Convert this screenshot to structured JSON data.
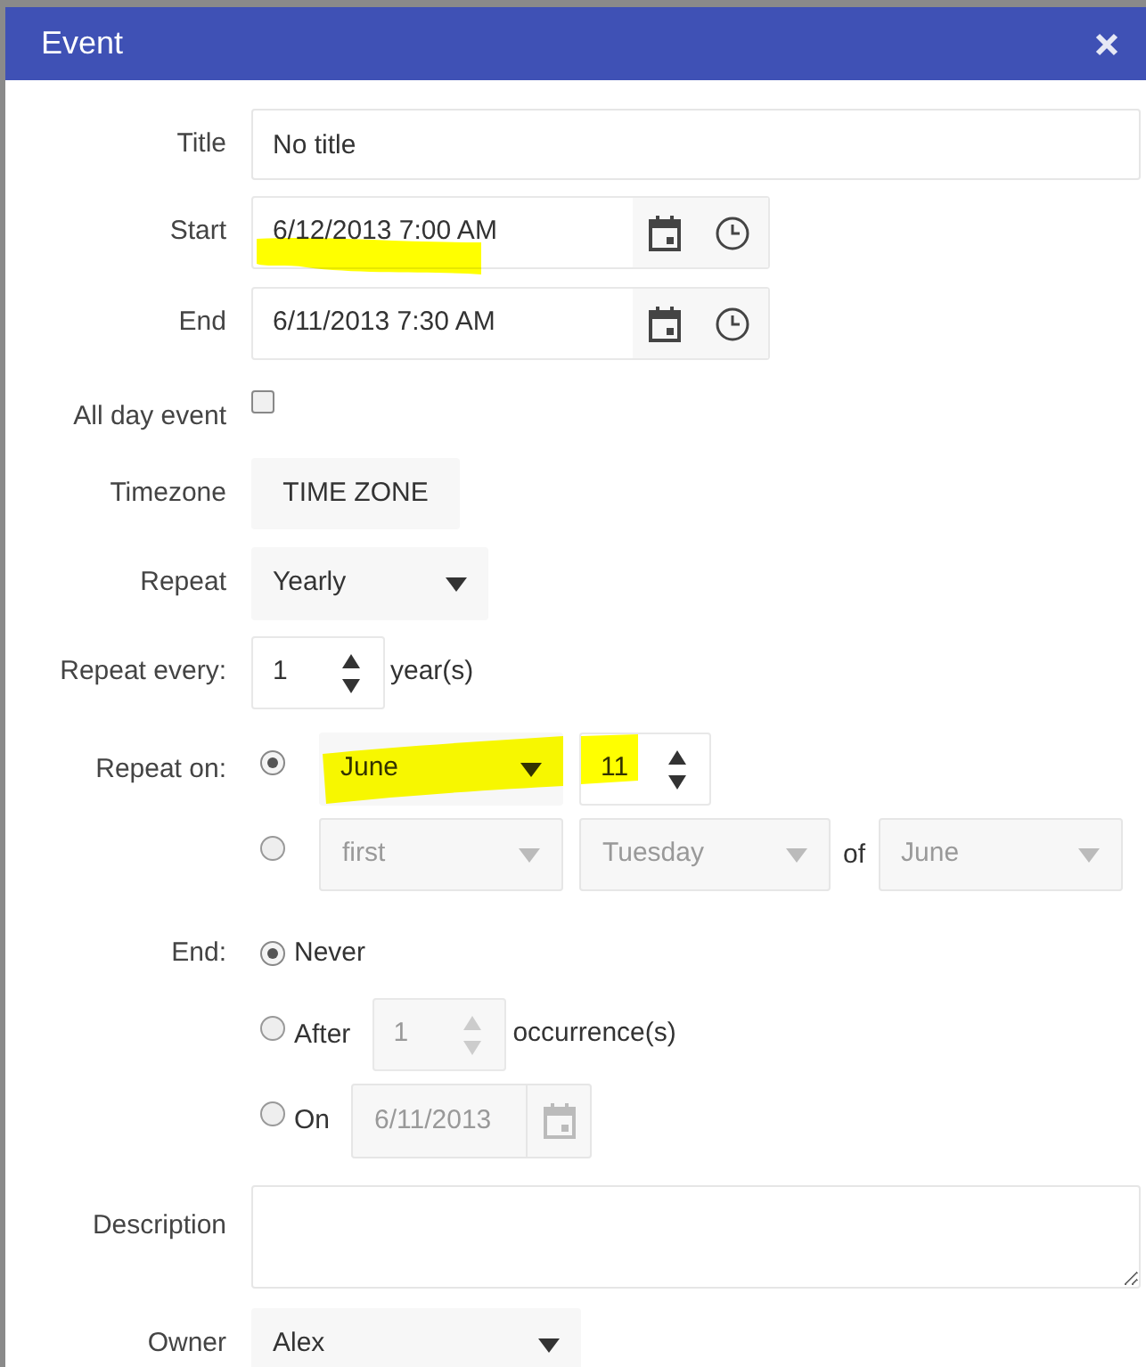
{
  "dialog": {
    "title": "Event"
  },
  "title": {
    "label": "Title",
    "value": "No title"
  },
  "start": {
    "label": "Start",
    "value": "6/12/2013 7:00 AM",
    "highlighted": true
  },
  "end": {
    "label": "End",
    "value": "6/11/2013 7:30 AM",
    "highlighted": false
  },
  "all_day": {
    "label": "All day event",
    "checked": false
  },
  "timezone": {
    "label": "Timezone",
    "button": "TIME ZONE"
  },
  "repeat": {
    "label": "Repeat",
    "value": "Yearly"
  },
  "repeat_every": {
    "label": "Repeat every:",
    "value": "1",
    "unit": "year(s)"
  },
  "repeat_on": {
    "label": "Repeat on:",
    "options": [
      {
        "kind": "date",
        "selected": true,
        "disabled": false,
        "highlighted": true,
        "month": "June",
        "day": "11"
      },
      {
        "kind": "relative",
        "selected": false,
        "disabled": true,
        "highlighted": false,
        "ordinal": "first",
        "weekday": "Tuesday",
        "of": "of",
        "month": "June"
      }
    ]
  },
  "end_rule": {
    "label": "End:",
    "options": [
      {
        "kind": "never",
        "label": "Never",
        "selected": true
      },
      {
        "kind": "after",
        "label": "After",
        "selected": false,
        "disabled": true,
        "value": "1",
        "unit": "occurrence(s)"
      },
      {
        "kind": "on",
        "label": "On",
        "selected": false,
        "disabled": true,
        "value": "6/11/2013"
      }
    ]
  },
  "description": {
    "label": "Description"
  },
  "owner": {
    "label": "Owner",
    "value": "Alex"
  }
}
